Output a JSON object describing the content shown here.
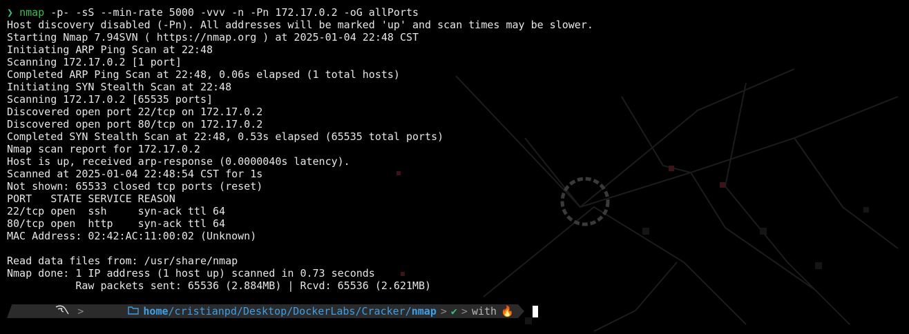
{
  "command": {
    "arrow": "❯",
    "program": "nmap",
    "args": " -p- -sS --min-rate 5000 -vvv -n -Pn 172.17.0.2 -oG allPorts"
  },
  "output_lines": [
    "Host discovery disabled (-Pn). All addresses will be marked 'up' and scan times may be slower.",
    "Starting Nmap 7.94SVN ( https://nmap.org ) at 2025-01-04 22:48 CST",
    "Initiating ARP Ping Scan at 22:48",
    "Scanning 172.17.0.2 [1 port]",
    "Completed ARP Ping Scan at 22:48, 0.06s elapsed (1 total hosts)",
    "Initiating SYN Stealth Scan at 22:48",
    "Scanning 172.17.0.2 [65535 ports]",
    "Discovered open port 22/tcp on 172.17.0.2",
    "Discovered open port 80/tcp on 172.17.0.2",
    "Completed SYN Stealth Scan at 22:48, 0.53s elapsed (65535 total ports)",
    "Nmap scan report for 172.17.0.2",
    "Host is up, received arp-response (0.0000040s latency).",
    "Scanned at 2025-01-04 22:48:54 CST for 1s",
    "Not shown: 65533 closed tcp ports (reset)",
    "PORT   STATE SERVICE REASON",
    "22/tcp open  ssh     syn-ack ttl 64",
    "80/tcp open  http    syn-ack ttl 64",
    "MAC Address: 02:42:AC:11:00:02 (Unknown)",
    "",
    "Read data files from: /usr/share/nmap",
    "Nmap done: 1 IP address (1 host up) scanned in 0.73 seconds",
    "           Raw packets sent: 65536 (2.884MB) | Rcvd: 65536 (2.621MB)"
  ],
  "prompt": {
    "os_icon": "kali-dragon-icon",
    "folder_icon": "folder-icon",
    "path_home": "home",
    "path_middle": "/cristianpd/Desktop/DockerLabs/Cracker/",
    "path_current": "nmap",
    "separator": ">",
    "status_check": "✔",
    "with_label": "with",
    "fire_icon": "🔥"
  },
  "colors": {
    "background": "#000000",
    "text": "#e6e6e6",
    "command": "#33c14a",
    "path": "#3aa0e8",
    "prompt_bar": "#2b2b2b"
  }
}
